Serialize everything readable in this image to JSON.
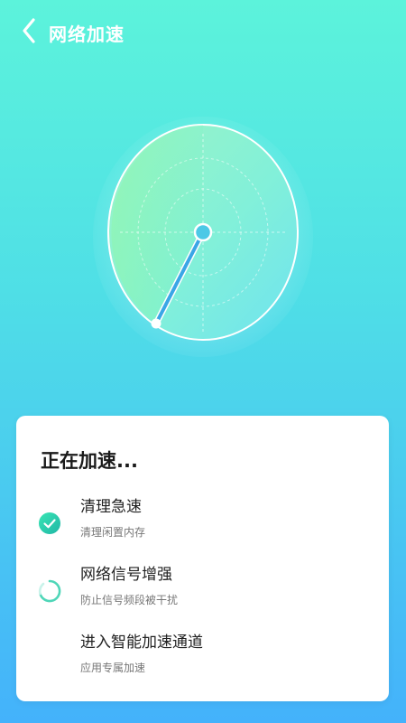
{
  "header": {
    "title": "网络加速",
    "back_icon": "chevron-left-icon"
  },
  "card": {
    "title": "正在加速...",
    "steps": [
      {
        "title": "清理急速",
        "subtitle": "清理闲置内存",
        "status": "done",
        "icon": "check-circle-icon"
      },
      {
        "title": "网络信号增强",
        "subtitle": "防止信号频段被干扰",
        "status": "in-progress",
        "icon": "loading-spinner-icon"
      },
      {
        "title": "进入智能加速通道",
        "subtitle": "应用专属加速",
        "status": "pending"
      }
    ]
  },
  "colors": {
    "bg_top": "#5cf3db",
    "bg_bottom": "#44b2fb",
    "accent": "#3cb8d8",
    "done_green": "#2fd3a4"
  }
}
